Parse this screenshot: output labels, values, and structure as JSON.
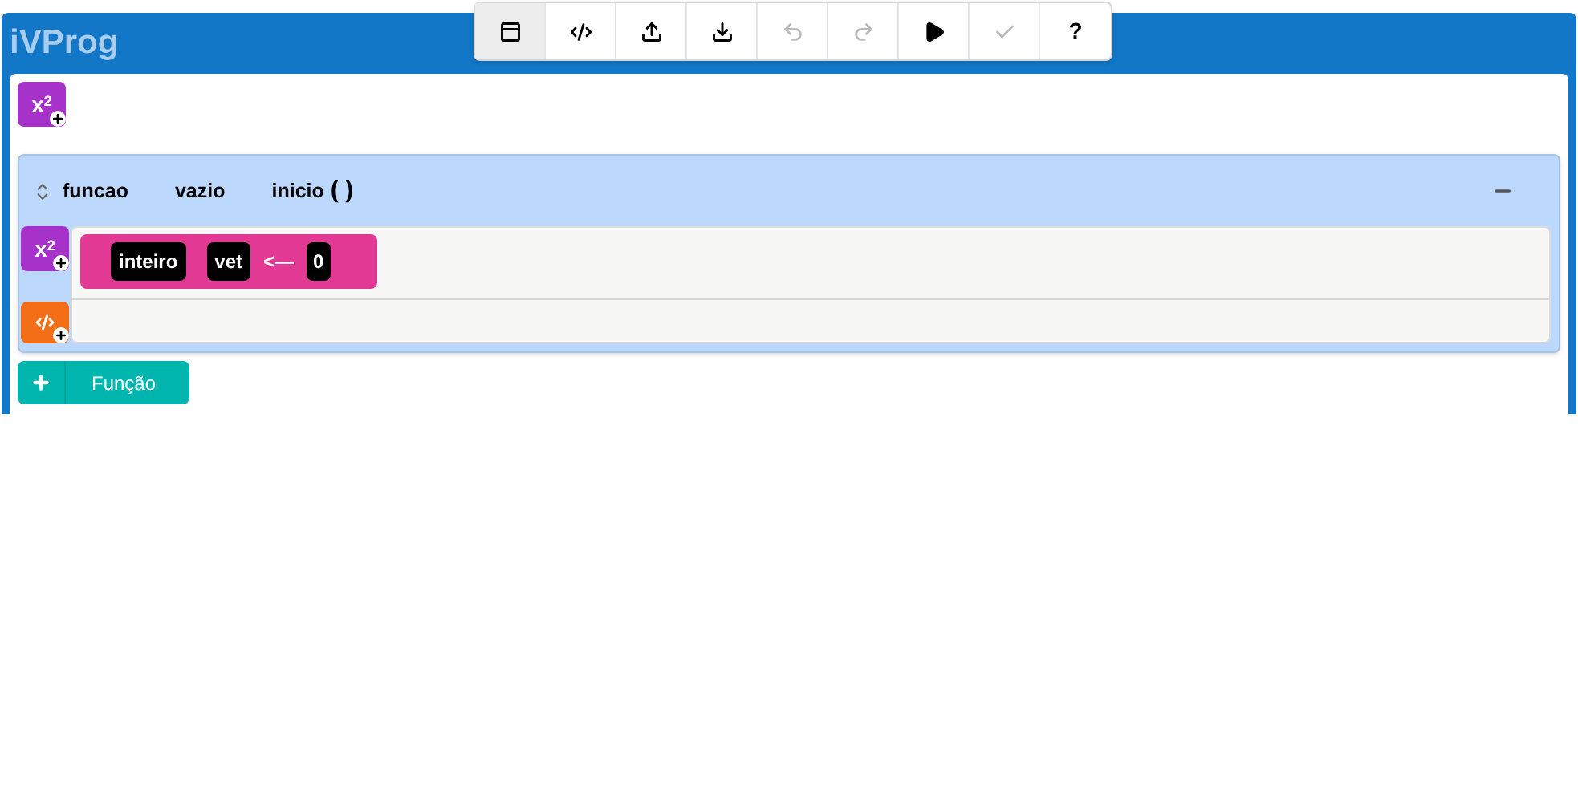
{
  "app_title": "iVProg",
  "add_variable_label": "x$^{2}$",
  "body_add_variable_label": "x$^{2}$",
  "toolbar": [
    {
      "kind": "window",
      "selected": true,
      "disabled": false
    },
    {
      "kind": "code",
      "selected": false,
      "disabled": false
    },
    {
      "kind": "upload",
      "selected": false,
      "disabled": false
    },
    {
      "kind": "download",
      "selected": false,
      "disabled": false
    },
    {
      "kind": "undo",
      "selected": false,
      "disabled": true
    },
    {
      "kind": "redo",
      "selected": false,
      "disabled": true
    },
    {
      "kind": "run",
      "selected": false,
      "disabled": false
    },
    {
      "kind": "check",
      "selected": false,
      "disabled": true
    },
    {
      "kind": "help",
      "label": "?",
      "selected": false,
      "disabled": false
    }
  ],
  "function": {
    "keyword": "funcao",
    "return_type": "vazio",
    "name": "inicio",
    "parens": "( )",
    "expanded": true,
    "declarations": [
      {
        "type": "inteiro",
        "name": "vet",
        "operator": "<—",
        "value": "0"
      }
    ]
  },
  "add_function_button": {
    "label": "Função"
  }
}
